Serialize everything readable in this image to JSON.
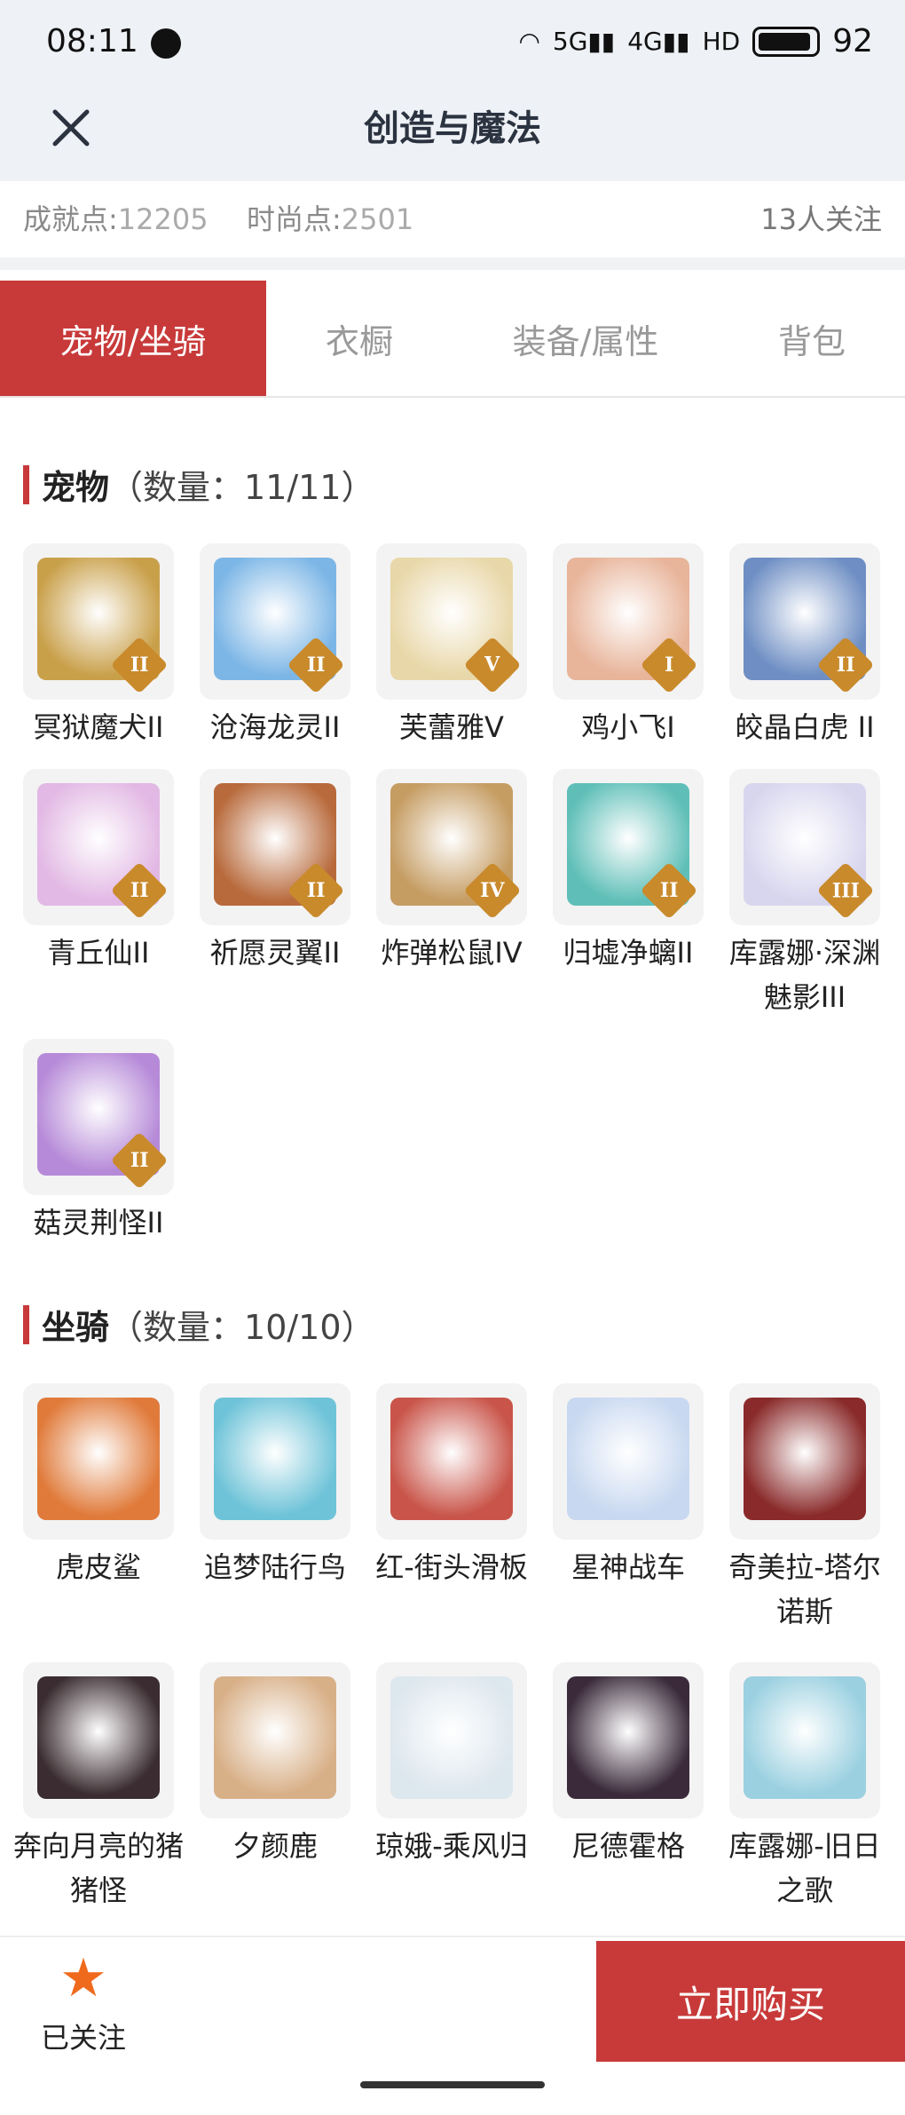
{
  "status": {
    "time": "08:11",
    "net1": "5G",
    "net2": "4G",
    "hd": "HD",
    "battery": "92"
  },
  "nav": {
    "title": "创造与魔法"
  },
  "points": {
    "achievement_label": "成就点:",
    "achievement_value": "12205",
    "fashion_label": "时尚点:",
    "fashion_value": "2501",
    "followers": "13人关注"
  },
  "tabs": [
    "宠物/坐骑",
    "衣橱",
    "装备/属性",
    "背包"
  ],
  "pets": {
    "title": "宠物",
    "count": "（数量：11/11）",
    "items": [
      {
        "name": "冥狱魔犬II",
        "tier": "II",
        "color": "#c9a04a"
      },
      {
        "name": "沧海龙灵II",
        "tier": "II",
        "color": "#7cb6e6"
      },
      {
        "name": "芙蕾雅V",
        "tier": "V",
        "color": "#e8d7a8"
      },
      {
        "name": "鸡小飞I",
        "tier": "I",
        "color": "#e8b49a"
      },
      {
        "name": "皎晶白虎 II",
        "tier": "II",
        "color": "#6f8fc4"
      },
      {
        "name": "青丘仙II",
        "tier": "II",
        "color": "#e2b8e4"
      },
      {
        "name": "祈愿灵翼II",
        "tier": "II",
        "color": "#b86a3c"
      },
      {
        "name": "炸弹松鼠IV",
        "tier": "IV",
        "color": "#c59c62"
      },
      {
        "name": "归墟净螭II",
        "tier": "II",
        "color": "#5fbfb8"
      },
      {
        "name": "库露娜·深渊魅影III",
        "tier": "III",
        "color": "#d8d6ee"
      },
      {
        "name": "菇灵荆怪II",
        "tier": "II",
        "color": "#b68ad8"
      }
    ]
  },
  "mounts": {
    "title": "坐骑",
    "count": "（数量：10/10）",
    "items": [
      {
        "name": "虎皮鲨",
        "color": "#e07a3a"
      },
      {
        "name": "追梦陆行鸟",
        "color": "#6ec3d8"
      },
      {
        "name": "红-街头滑板",
        "color": "#c9554a"
      },
      {
        "name": "星神战车",
        "color": "#c8d8f0"
      },
      {
        "name": "奇美拉-塔尔诺斯",
        "color": "#8a2a2a"
      },
      {
        "name": "奔向月亮的猪猪怪",
        "color": "#3a2c30"
      },
      {
        "name": "夕颜鹿",
        "color": "#d8b088"
      },
      {
        "name": "琼娥-乘风归",
        "color": "#dde7ee"
      },
      {
        "name": "尼德霍格",
        "color": "#3a2a3a"
      },
      {
        "name": "库露娜-旧日之歌",
        "color": "#9ad0e0"
      }
    ]
  },
  "bottom": {
    "fav_label": "已关注",
    "buy_label": "立即购买"
  },
  "colors": {
    "accent": "#c83a3a",
    "badge": "#c98a2c",
    "star": "#f06a1e"
  }
}
